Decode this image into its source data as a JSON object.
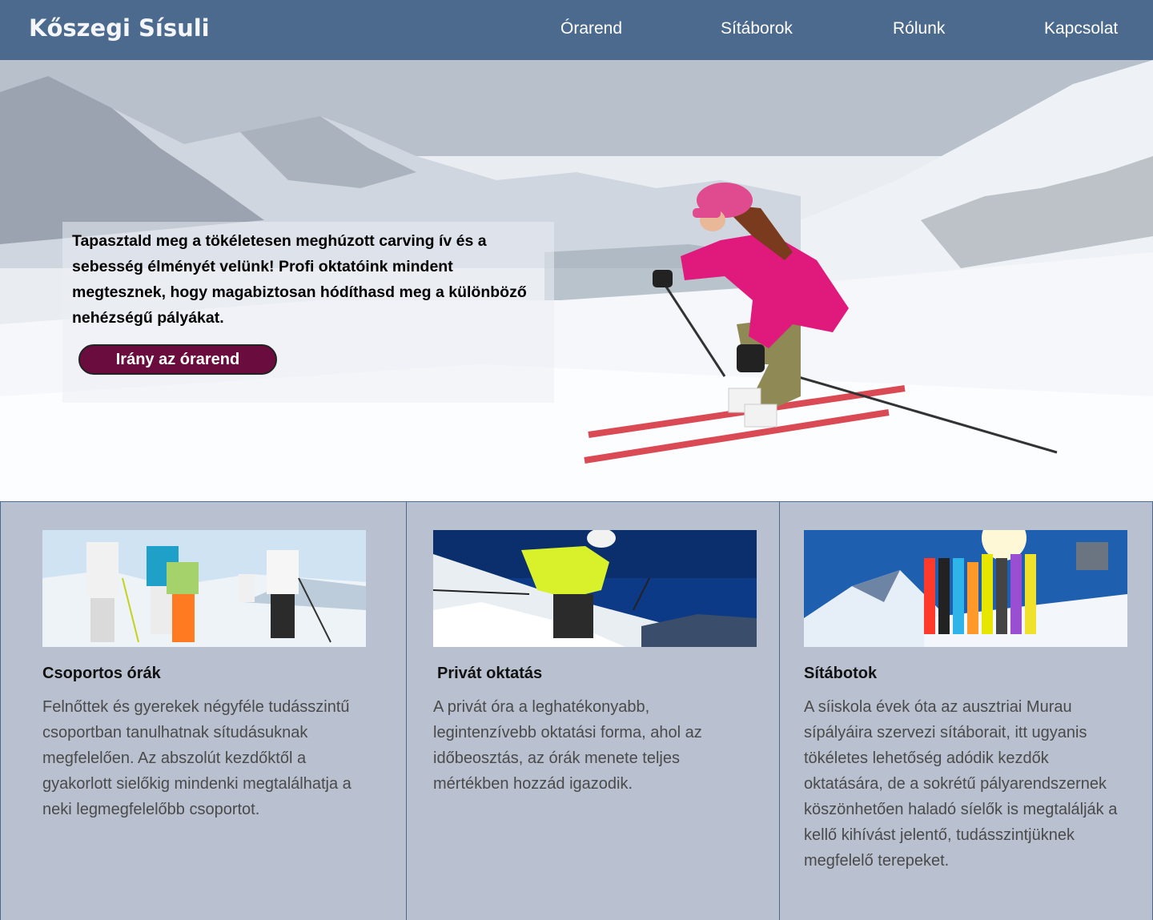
{
  "header": {
    "brand": "Kőszegi Sísuli",
    "nav": [
      "Órarend",
      "Sítáborok",
      "Rólunk",
      "Kapcsolat"
    ]
  },
  "hero": {
    "text": "Tapasztald meg a tökéletesen meghúzott carving ív és a sebesség élményét velünk! Profi oktatóink mindent megtesznek, hogy magabiztosan hódíthasd meg a különböző nehézségű pályákat.",
    "button": "Irány az órarend"
  },
  "cards": [
    {
      "title": "Csoportos órák",
      "body": "Felnőttek és gyerekek négyféle tudásszintű csoportban tanulhatnak sítudásuknak megfelelően. Az abszolút kezdőktől a gyakorlott sielőkig mindenki megtalálhatja a neki legmegfelelőbb csoportot."
    },
    {
      "title": "Privát oktatás",
      "body": "A privát óra a leghatékonyabb, legintenzívebb oktatási forma, ahol az időbeosztás, az órák menete teljes mértékben hozzád igazodik."
    },
    {
      "title": "Sítábotok",
      "body": "A síiskola évek óta az ausztriai Murau sípályáira szervezi sítáborait, itt ugyanis tökéletes lehetőség adódik kezdők oktatására, de a sokrétű pályarendszernek köszönhetően haladó síelők is megtalálják a kellő kihívást jelentő, tudásszintjüknek megfelelő terepeket."
    }
  ],
  "colors": {
    "header_bg": "#4b6a8d",
    "card_bg": "#b9c0cf",
    "button_bg": "#6b0c3e",
    "jacket_pink": "#e0197d"
  }
}
